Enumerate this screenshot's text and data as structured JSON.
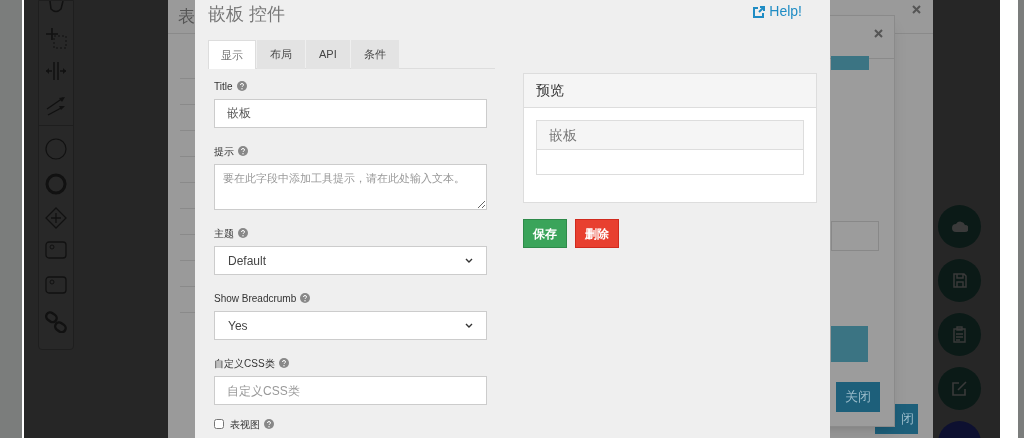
{
  "back_dialog": {
    "title": "表"
  },
  "second_dialog": {
    "close_button": "关闭"
  },
  "back_button": {
    "label": "闭"
  },
  "dialog": {
    "title": "嵌板 控件",
    "help_link": "Help!",
    "tabs": [
      {
        "label": "显示",
        "selected": true
      },
      {
        "label": "布局",
        "selected": false
      },
      {
        "label": "API",
        "selected": false
      },
      {
        "label": "条件",
        "selected": false
      }
    ],
    "fields": [
      {
        "kind": "text",
        "label": "Title",
        "value": "嵌板"
      },
      {
        "kind": "textarea",
        "label": "提示",
        "placeholder": "要在此字段中添加工具提示，请在此处输入文本。"
      },
      {
        "kind": "select",
        "label": "主题",
        "value": "Default"
      },
      {
        "kind": "select",
        "label": "Show Breadcrumb",
        "value": "Yes"
      },
      {
        "kind": "text",
        "label": "自定义CSS类",
        "placeholder": "自定义CSS类"
      },
      {
        "kind": "checkbox",
        "label": "表视图",
        "checked": false
      }
    ],
    "preview": {
      "title": "预览",
      "panel_heading": "嵌板"
    },
    "buttons": [
      {
        "label": "保存",
        "kind": "success"
      },
      {
        "label": "删除",
        "kind": "danger"
      }
    ]
  }
}
